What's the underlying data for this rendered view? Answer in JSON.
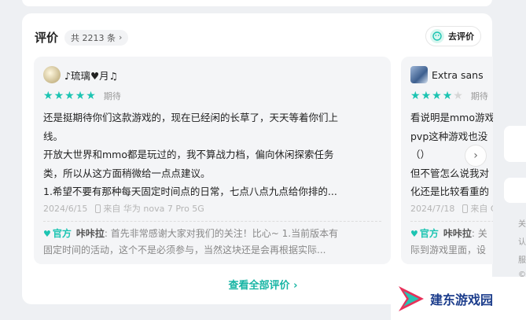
{
  "section": {
    "title": "评价",
    "count": "共 2213 条",
    "write_review": "去评价",
    "view_all": "查看全部评价 ›"
  },
  "reviews": [
    {
      "username": "♪琉璃♥月♫",
      "rating": 5,
      "rating_label": "期待",
      "lines": [
        "还是挺期待你们这款游戏的，现在已经闲的长草了，天天等着你们上",
        "线。",
        "开放大世界和mmo都是玩过的，我不算战力档，偏向休闲探索任务",
        "类，所以从这方面稍微给一点点建议。",
        "1.希望不要有那种每天固定时间点的日常，七点八点九点给你排的..."
      ],
      "date": "2024/6/15",
      "device": "来自 华为 nova 7 Pro 5G",
      "reply": {
        "tag": "官方",
        "author": "咔咔拉",
        "line1": ": 首先非常感谢大家对我们的关注！比心~ 1.当前版本有",
        "line2": "固定时间的活动，这个不是必须参与，当然这块还是会再根据实际..."
      }
    },
    {
      "username": "Extra sans",
      "rating": 4,
      "rating_label": "期待",
      "lines": [
        "看说明是mmo游戏",
        "pvp这种游戏也没",
        "（）",
        "但不管怎么说我对",
        "化还是比较看重的"
      ],
      "date": "2024/7/18",
      "device": "来自 C",
      "reply": {
        "tag": "官方",
        "author": "咔咔拉",
        "line1": ": 关",
        "line2": "际到游戏里面，设"
      }
    }
  ],
  "right_strip": [
    "关",
    "认",
    "服",
    "©"
  ],
  "watermark": "建东游戏园",
  "colors": {
    "accent": "#1cc4b2",
    "star_off": "#d6d6d6"
  }
}
